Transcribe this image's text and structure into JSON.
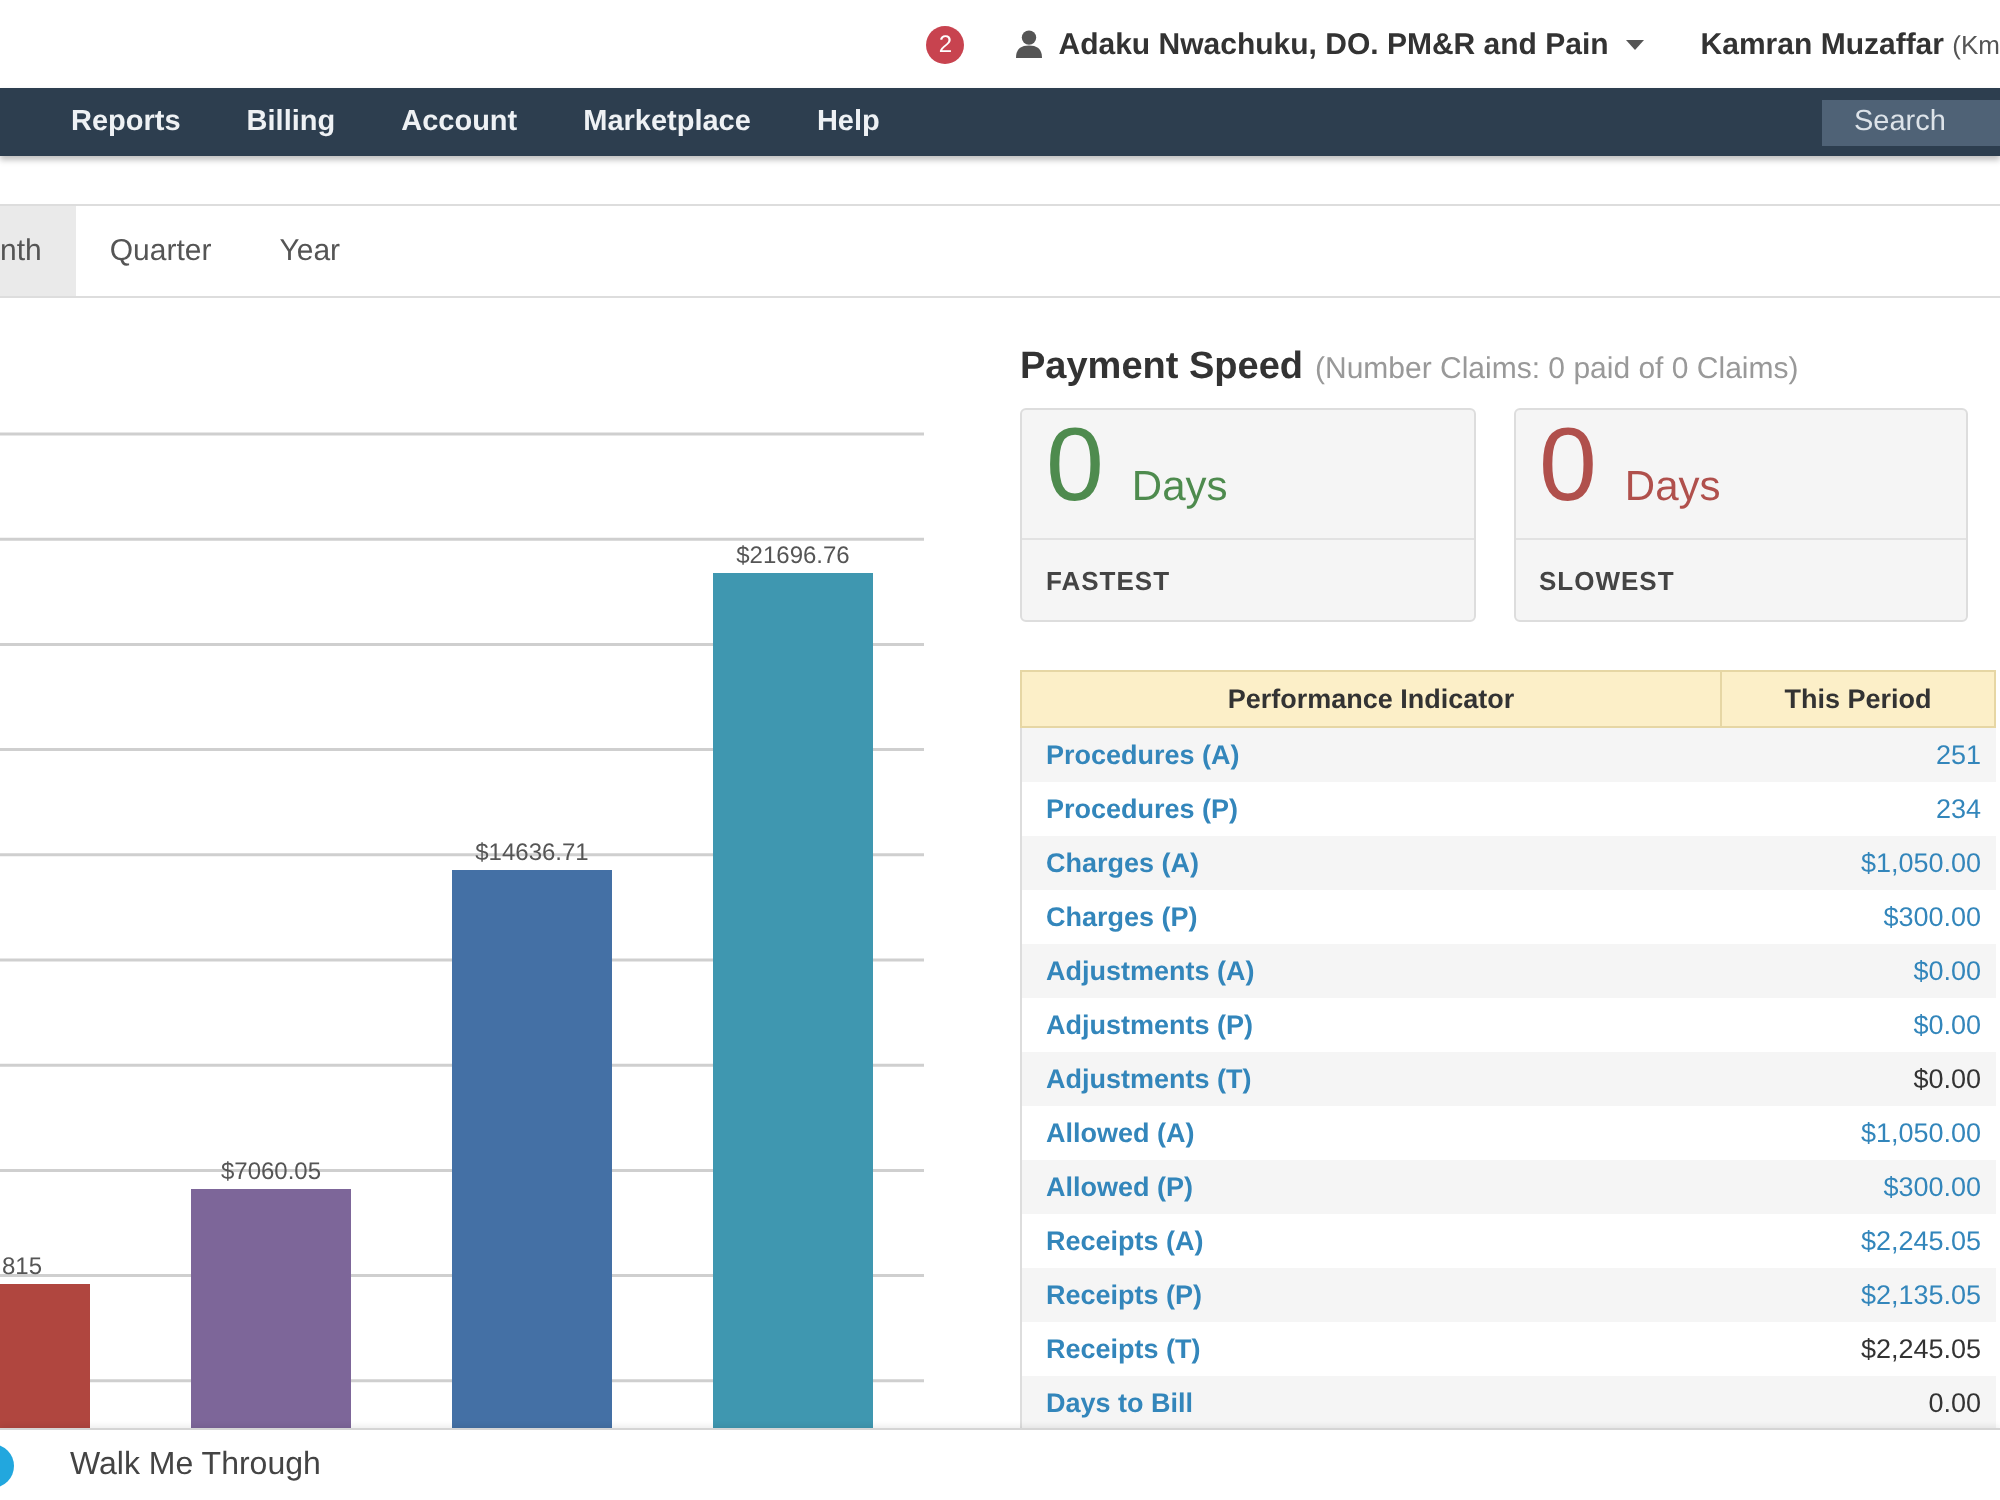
{
  "top_bar": {
    "notifications": {
      "count": "2"
    },
    "user": {
      "name": "Adaku Nwachuku, DO. PM&R and Pain"
    },
    "account": {
      "name": "Kamran Muzaffar",
      "suffix": "(Km"
    }
  },
  "nav": {
    "items": [
      {
        "label": "Reports"
      },
      {
        "label": "Billing"
      },
      {
        "label": "Account"
      },
      {
        "label": "Marketplace"
      },
      {
        "label": "Help"
      }
    ],
    "search": {
      "placeholder": "Search"
    }
  },
  "period_tabs": [
    {
      "label": "nth",
      "selected": true
    },
    {
      "label": "Quarter",
      "selected": false
    },
    {
      "label": "Year",
      "selected": false
    }
  ],
  "revenue_chart": {
    "bars": [
      {
        "value_label": "815",
        "color": "#b0463f"
      },
      {
        "value_label": "$7060.05",
        "color": "#7d6699"
      },
      {
        "value_label": "$14636.71",
        "color": "#4470a5"
      },
      {
        "value_label": "$21696.76",
        "color": "#3f97b0"
      }
    ]
  },
  "payment_speed": {
    "title": "Payment Speed",
    "subtitle": "(Number Claims: 0 paid of 0 Claims)",
    "cards": [
      {
        "value": "0",
        "unit": "Days",
        "label": "FASTEST",
        "color": "#4e8b4e"
      },
      {
        "value": "0",
        "unit": "Days",
        "label": "SLOWEST",
        "color": "#b0504c"
      }
    ]
  },
  "performance_table": {
    "columns": [
      "Performance Indicator",
      "This Period"
    ],
    "rows": [
      {
        "indicator": "Procedures (A)",
        "value": "251",
        "value_link": true
      },
      {
        "indicator": "Procedures (P)",
        "value": "234",
        "value_link": true
      },
      {
        "indicator": "Charges (A)",
        "value": "$1,050.00",
        "value_link": true
      },
      {
        "indicator": "Charges (P)",
        "value": "$300.00",
        "value_link": true
      },
      {
        "indicator": "Adjustments (A)",
        "value": "$0.00",
        "value_link": true
      },
      {
        "indicator": "Adjustments (P)",
        "value": "$0.00",
        "value_link": true
      },
      {
        "indicator": "Adjustments (T)",
        "value": "$0.00",
        "value_link": false
      },
      {
        "indicator": "Allowed (A)",
        "value": "$1,050.00",
        "value_link": true
      },
      {
        "indicator": "Allowed (P)",
        "value": "$300.00",
        "value_link": true
      },
      {
        "indicator": "Receipts (A)",
        "value": "$2,245.05",
        "value_link": true
      },
      {
        "indicator": "Receipts (P)",
        "value": "$2,135.05",
        "value_link": true
      },
      {
        "indicator": "Receipts (T)",
        "value": "$2,245.05",
        "value_link": false
      },
      {
        "indicator": "Days to Bill",
        "value": "0.00",
        "value_link": false
      }
    ]
  },
  "footer": {
    "label": "Walk Me Through"
  }
}
